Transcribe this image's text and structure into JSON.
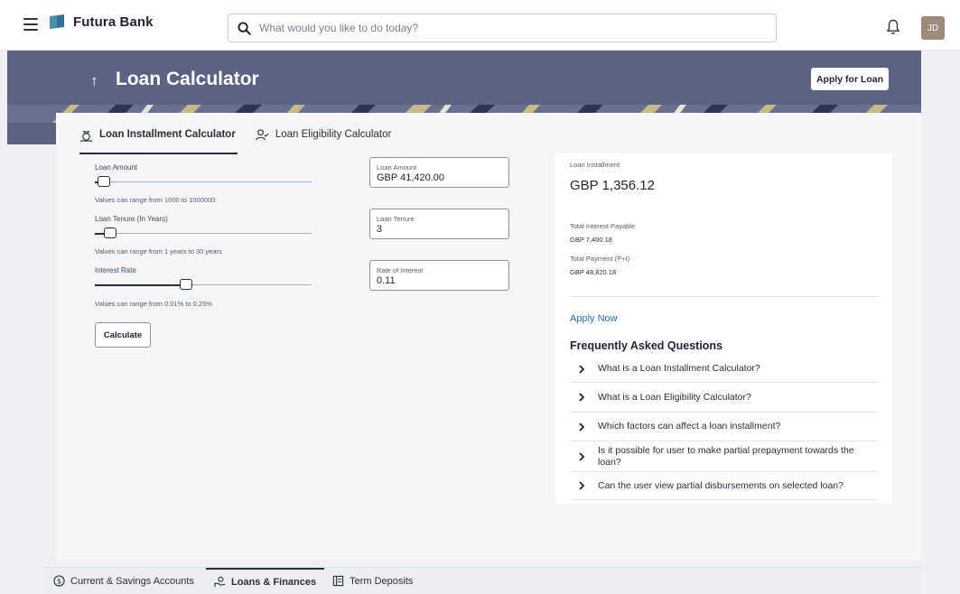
{
  "app": {
    "name": "Futura Bank",
    "avatar_initials": "JD"
  },
  "search": {
    "placeholder": "What would you like to do today?"
  },
  "header": {
    "title": "Loan Calculator",
    "apply_button": "Apply for Loan"
  },
  "tabs": [
    {
      "label": "Loan Installment Calculator",
      "active": true
    },
    {
      "label": "Loan Eligibility Calculator",
      "active": false
    }
  ],
  "sliders": {
    "loan_amount": {
      "label": "Loan Amount",
      "hint": "Values can range from 1000 to 1000000",
      "level": 0.04
    },
    "loan_tenure": {
      "label": "Loan Tenure (In Years)",
      "hint": "Values can range from 1 years to 30 years",
      "level": 0.07
    },
    "interest_rate": {
      "label": "Interest Rate",
      "hint": "Values can range from 0.01% to 0.25%",
      "level": 0.42
    }
  },
  "fields": {
    "loan_amount": {
      "label": "Loan Amount",
      "value": "GBP 41,420.00"
    },
    "loan_tenure": {
      "label": "Loan Tenure",
      "value": "3"
    },
    "rate_of_interest": {
      "label": "Rate of Interest",
      "value": "0.11"
    }
  },
  "calculate_button": "Calculate",
  "result": {
    "installment_label": "Loan Installment",
    "installment_value": "GBP 1,356.12",
    "interest_label": "Total Interest Payable",
    "interest_value": "GBP 7,400.18",
    "payment_label": "Total Payment (P+I)",
    "payment_value": "GBP 48,820.18",
    "apply_now": "Apply Now"
  },
  "faq": {
    "title": "Frequently Asked Questions",
    "items": [
      "What is a Loan Installment Calculator?",
      "What is a Loan Eligibility Calculator?",
      "Which factors can affect a loan installment?",
      "Is it possible for user to make partial prepayment towards the loan?",
      "Can the user view partial disbursements on selected loan?"
    ]
  },
  "bottom_nav": [
    {
      "label": "Current & Savings Accounts",
      "icon": "dollar-circle-icon",
      "active": false
    },
    {
      "label": "Loans & Finances",
      "icon": "loan-hand-icon",
      "active": true
    },
    {
      "label": "Term Deposits",
      "icon": "ledger-icon",
      "active": false
    }
  ],
  "colors": {
    "band": "#5c6382",
    "accent": "#2a6fb0",
    "text": "#1f2430"
  }
}
